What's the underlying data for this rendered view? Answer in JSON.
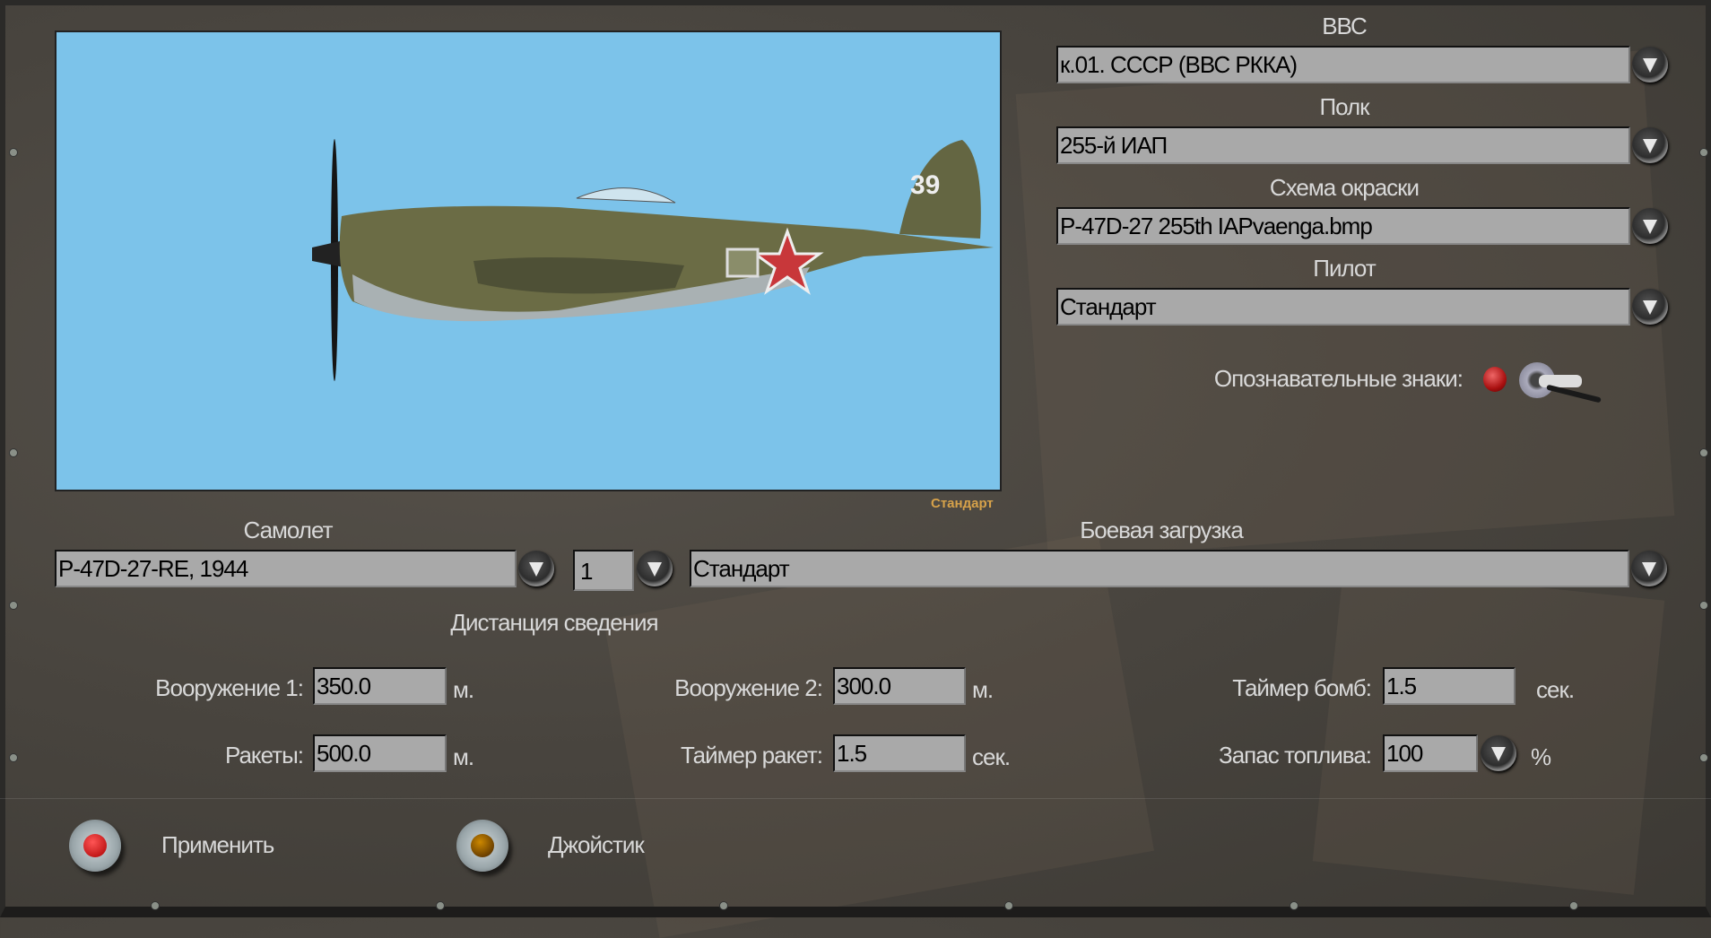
{
  "preview": {
    "bg_color": "#7cc3ea",
    "caption": "Стандарт",
    "tail_number": "39"
  },
  "right": {
    "air_force_label": "ВВС",
    "air_force_value": "к.01. СССР (ВВС РККА)",
    "regiment_label": "Полк",
    "regiment_value": "255-й ИАП",
    "skin_label": "Схема окраски",
    "skin_value": "P-47D-27 255th IAPvaenga.bmp",
    "pilot_label": "Пилот",
    "pilot_value": "Стандарт",
    "markings_label": "Опознавательные знаки:"
  },
  "aircraft": {
    "label": "Самолет",
    "value": "P-47D-27-RE, 1944",
    "count": "1"
  },
  "loadout": {
    "label": "Боевая загрузка",
    "value": "Стандарт"
  },
  "convergence": {
    "title": "Дистанция сведения",
    "weapon1_label": "Вооружение 1:",
    "weapon1_value": "350.0",
    "weapon1_unit": "м.",
    "weapon2_label": "Вооружение 2:",
    "weapon2_value": "300.0",
    "weapon2_unit": "м.",
    "bomb_timer_label": "Таймер бомб:",
    "bomb_timer_value": "1.5",
    "bomb_timer_unit": "сек.",
    "rockets_label": "Ракеты:",
    "rockets_value": "500.0",
    "rockets_unit": "м.",
    "rocket_timer_label": "Таймер ракет:",
    "rocket_timer_value": "1.5",
    "rocket_timer_unit": "сек.",
    "fuel_label": "Запас топлива:",
    "fuel_value": "100",
    "fuel_unit": "%"
  },
  "buttons": {
    "apply": "Применить",
    "joystick": "Джойстик"
  }
}
